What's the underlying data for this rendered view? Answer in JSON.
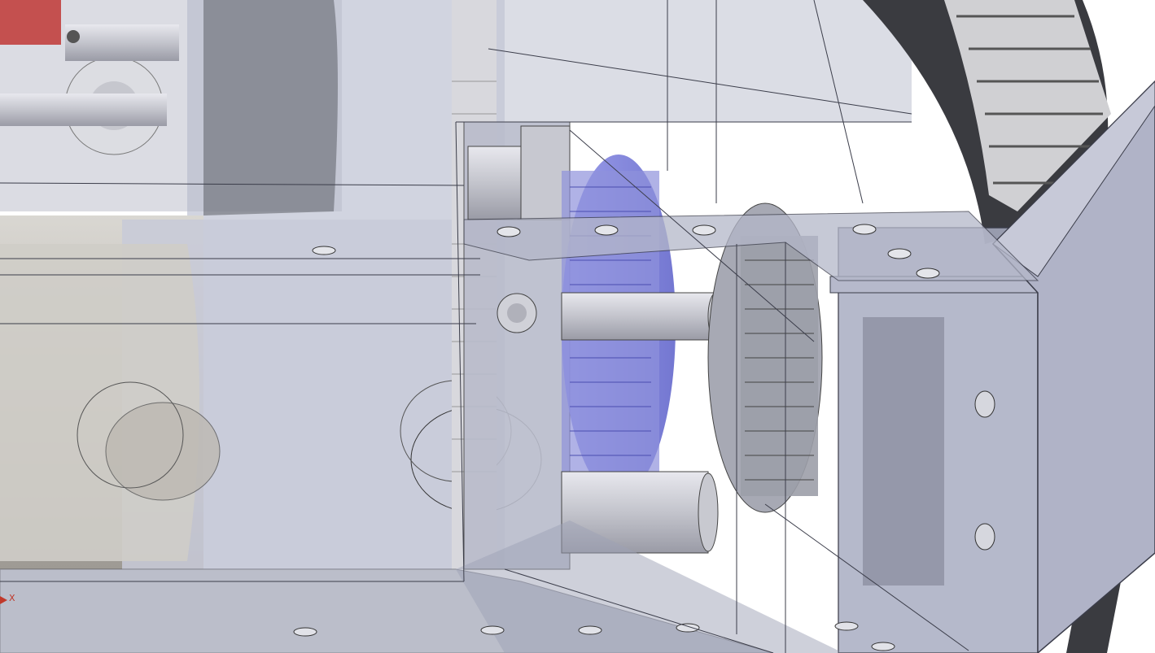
{
  "viewport": {
    "colors": {
      "background": "#ffffff",
      "transparent_housing": "#a9adc2",
      "housing_edge": "#3b3d4a",
      "pulley_highlight": "#6b6fd8",
      "motor_gray": "#b8b4ad",
      "red_part": "#c4504f",
      "gear_gray": "#cfcfd4",
      "wheel_tread": "#6e6e6e"
    }
  },
  "triad": {
    "x_label": "X",
    "x_color": "#c0392b"
  }
}
